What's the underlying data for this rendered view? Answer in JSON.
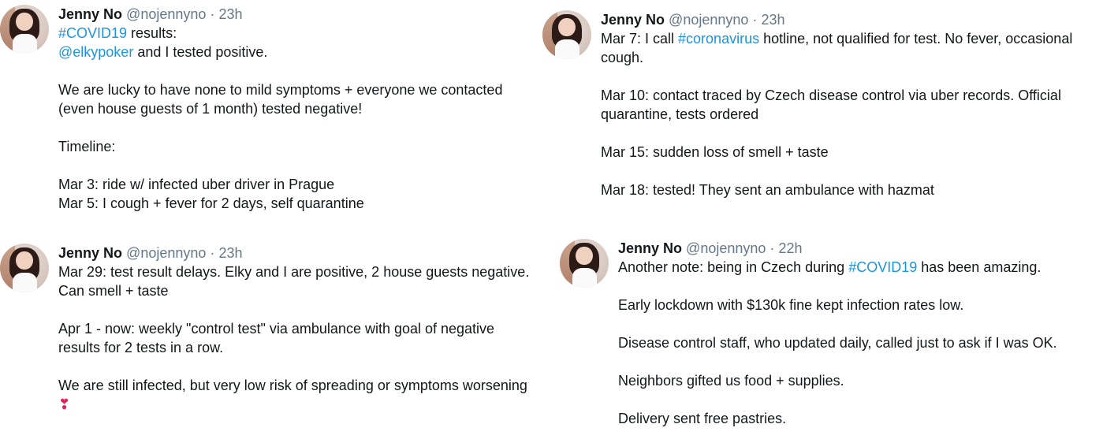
{
  "tweets": [
    {
      "name": "Jenny No",
      "handle": "@nojennyno",
      "separator": "·",
      "time": "23h",
      "lines": [
        {
          "parts": [
            {
              "t": "#COVID19",
              "link": true
            },
            {
              "t": " results:"
            }
          ]
        },
        {
          "parts": [
            {
              "t": "@elkypoker",
              "link": true
            },
            {
              "t": " and I tested positive."
            }
          ]
        },
        {
          "parts": []
        },
        {
          "parts": [
            {
              "t": "We are lucky to have none to mild symptoms + everyone we contacted"
            }
          ]
        },
        {
          "parts": [
            {
              "t": "(even house guests of 1 month) tested negative!"
            }
          ]
        },
        {
          "parts": []
        },
        {
          "parts": [
            {
              "t": "Timeline:"
            }
          ]
        },
        {
          "parts": []
        },
        {
          "parts": [
            {
              "t": "Mar 3: ride w/ infected uber driver in Prague"
            }
          ]
        },
        {
          "parts": [
            {
              "t": "Mar 5: I cough + fever for 2 days, self quarantine"
            }
          ]
        }
      ]
    },
    {
      "name": "Jenny No",
      "handle": "@nojennyno",
      "separator": "·",
      "time": "23h",
      "lines": [
        {
          "parts": [
            {
              "t": "Mar 7: I call "
            },
            {
              "t": "#coronavirus",
              "link": true
            },
            {
              "t": " hotline, not qualified for test. No fever, occasional"
            }
          ]
        },
        {
          "parts": [
            {
              "t": "cough."
            }
          ]
        },
        {
          "parts": []
        },
        {
          "parts": [
            {
              "t": "Mar 10: contact traced by Czech disease control via uber records. Official"
            }
          ]
        },
        {
          "parts": [
            {
              "t": "quarantine, tests ordered"
            }
          ]
        },
        {
          "parts": []
        },
        {
          "parts": [
            {
              "t": "Mar 15: sudden loss of smell + taste"
            }
          ]
        },
        {
          "parts": []
        },
        {
          "parts": [
            {
              "t": "Mar 18: tested! They sent an ambulance with hazmat"
            }
          ]
        }
      ]
    },
    {
      "name": "Jenny No",
      "handle": "@nojennyno",
      "separator": "·",
      "time": "23h",
      "lines": [
        {
          "parts": [
            {
              "t": "Mar 29: test result delays. Elky and I are positive, 2 house guests negative."
            }
          ]
        },
        {
          "parts": [
            {
              "t": "Can smell + taste"
            }
          ]
        },
        {
          "parts": []
        },
        {
          "parts": [
            {
              "t": "Apr 1 - now: weekly \"control test\" via ambulance with goal of negative"
            }
          ]
        },
        {
          "parts": [
            {
              "t": "results for 2 tests in a row."
            }
          ]
        },
        {
          "parts": []
        },
        {
          "parts": [
            {
              "t": "We are still infected, but very low risk of spreading or symptoms worsening"
            }
          ]
        },
        {
          "parts": [
            {
              "t": "❣",
              "emoji": true
            }
          ]
        }
      ]
    },
    {
      "name": "Jenny No",
      "handle": "@nojennyno",
      "separator": "·",
      "time": "22h",
      "lines": [
        {
          "parts": [
            {
              "t": "Another note: being in Czech during "
            },
            {
              "t": "#COVID19",
              "link": true
            },
            {
              "t": " has been amazing."
            }
          ]
        },
        {
          "parts": []
        },
        {
          "parts": [
            {
              "t": "Early lockdown with $130k fine kept infection rates low."
            }
          ]
        },
        {
          "parts": []
        },
        {
          "parts": [
            {
              "t": "Disease control staff, who updated daily, called just to ask if I was OK."
            }
          ]
        },
        {
          "parts": []
        },
        {
          "parts": [
            {
              "t": "Neighbors gifted us food + supplies."
            }
          ]
        },
        {
          "parts": []
        },
        {
          "parts": [
            {
              "t": "Delivery sent free pastries."
            }
          ]
        }
      ]
    }
  ]
}
